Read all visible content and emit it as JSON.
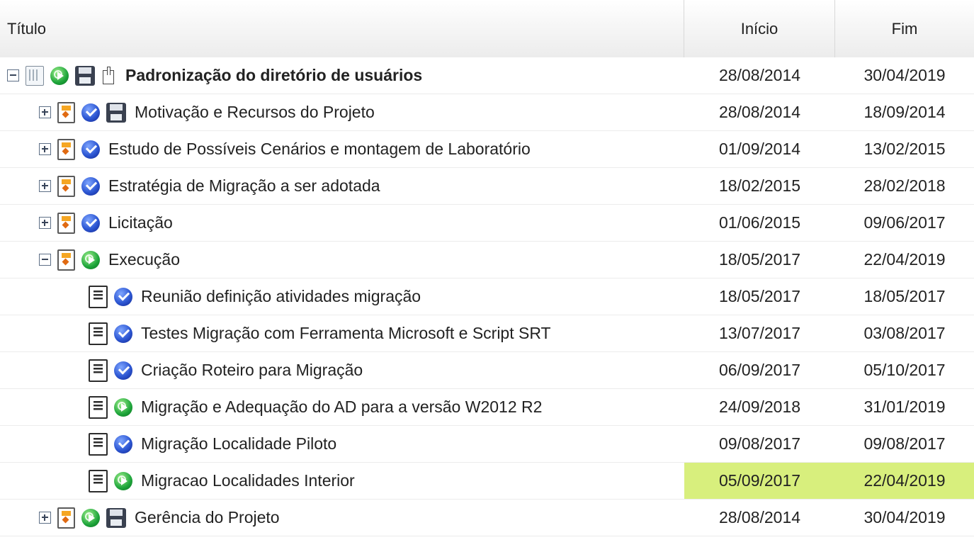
{
  "columns": {
    "title": "Título",
    "start": "Início",
    "end": "Fim"
  },
  "rows": [
    {
      "title": "Padronização do diretório de usuários",
      "start": "28/08/2014",
      "end": "30/04/2019",
      "level": 0,
      "toggle": "collapse",
      "type": "project",
      "status": "in-progress",
      "extras": [
        "save",
        "export"
      ]
    },
    {
      "title": "Motivação e Recursos do Projeto",
      "start": "28/08/2014",
      "end": "18/09/2014",
      "level": 1,
      "toggle": "expand",
      "type": "phase",
      "status": "done",
      "extras": [
        "save"
      ]
    },
    {
      "title": "Estudo de Possíveis Cenários e montagem de Laboratório",
      "start": "01/09/2014",
      "end": "13/02/2015",
      "level": 1,
      "toggle": "expand",
      "type": "phase",
      "status": "done",
      "extras": []
    },
    {
      "title": "Estratégia de Migração a ser adotada",
      "start": "18/02/2015",
      "end": "28/02/2018",
      "level": 1,
      "toggle": "expand",
      "type": "phase",
      "status": "done",
      "extras": []
    },
    {
      "title": "Licitação",
      "start": "01/06/2015",
      "end": "09/06/2017",
      "level": 1,
      "toggle": "expand",
      "type": "phase",
      "status": "done",
      "extras": []
    },
    {
      "title": "Execução",
      "start": "18/05/2017",
      "end": "22/04/2019",
      "level": 1,
      "toggle": "collapse",
      "type": "phase",
      "status": "in-progress",
      "extras": []
    },
    {
      "title": "Reunião definição atividades migração",
      "start": "18/05/2017",
      "end": "18/05/2017",
      "level": 2,
      "toggle": "none",
      "type": "task",
      "status": "done",
      "extras": []
    },
    {
      "title": "Testes Migração com Ferramenta Microsoft e Script SRT",
      "start": "13/07/2017",
      "end": "03/08/2017",
      "level": 2,
      "toggle": "none",
      "type": "task",
      "status": "done",
      "extras": []
    },
    {
      "title": "Criação Roteiro para Migração",
      "start": "06/09/2017",
      "end": "05/10/2017",
      "level": 2,
      "toggle": "none",
      "type": "task",
      "status": "done",
      "extras": []
    },
    {
      "title": "Migração e Adequação do AD para a versão W2012 R2",
      "start": "24/09/2018",
      "end": "31/01/2019",
      "level": 2,
      "toggle": "none",
      "type": "task",
      "status": "in-progress",
      "extras": []
    },
    {
      "title": "Migração Localidade Piloto",
      "start": "09/08/2017",
      "end": "09/08/2017",
      "level": 2,
      "toggle": "none",
      "type": "task",
      "status": "done",
      "extras": []
    },
    {
      "title": "Migracao Localidades Interior",
      "start": "05/09/2017",
      "end": "22/04/2019",
      "level": 2,
      "toggle": "none",
      "type": "task",
      "status": "in-progress",
      "extras": [],
      "highlight": true
    },
    {
      "title": "Gerência do Projeto",
      "start": "28/08/2014",
      "end": "30/04/2019",
      "level": 1,
      "toggle": "expand",
      "type": "phase",
      "status": "in-progress",
      "extras": [
        "save"
      ]
    }
  ],
  "highlight_color": "#d8ef7d"
}
